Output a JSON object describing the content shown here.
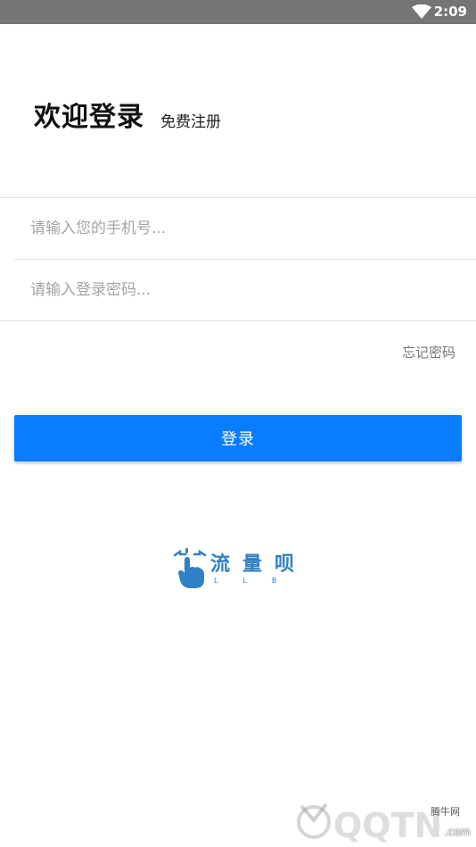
{
  "status_bar": {
    "time": "2:09"
  },
  "header": {
    "title": "欢迎登录",
    "register_label": "免费注册"
  },
  "form": {
    "phone_placeholder": "请输入您的手机号...",
    "password_placeholder": "请输入登录密码...",
    "forgot_label": "忘记密码",
    "login_label": "登录"
  },
  "logo": {
    "name": "流量呗",
    "sub": "LLB"
  },
  "watermark": {
    "text": "QQTN",
    "cn": "腾牛网",
    "com": ".com"
  },
  "colors": {
    "status_bar": "#757575",
    "primary": "#0a7cff",
    "logo": "#2f80c4"
  }
}
